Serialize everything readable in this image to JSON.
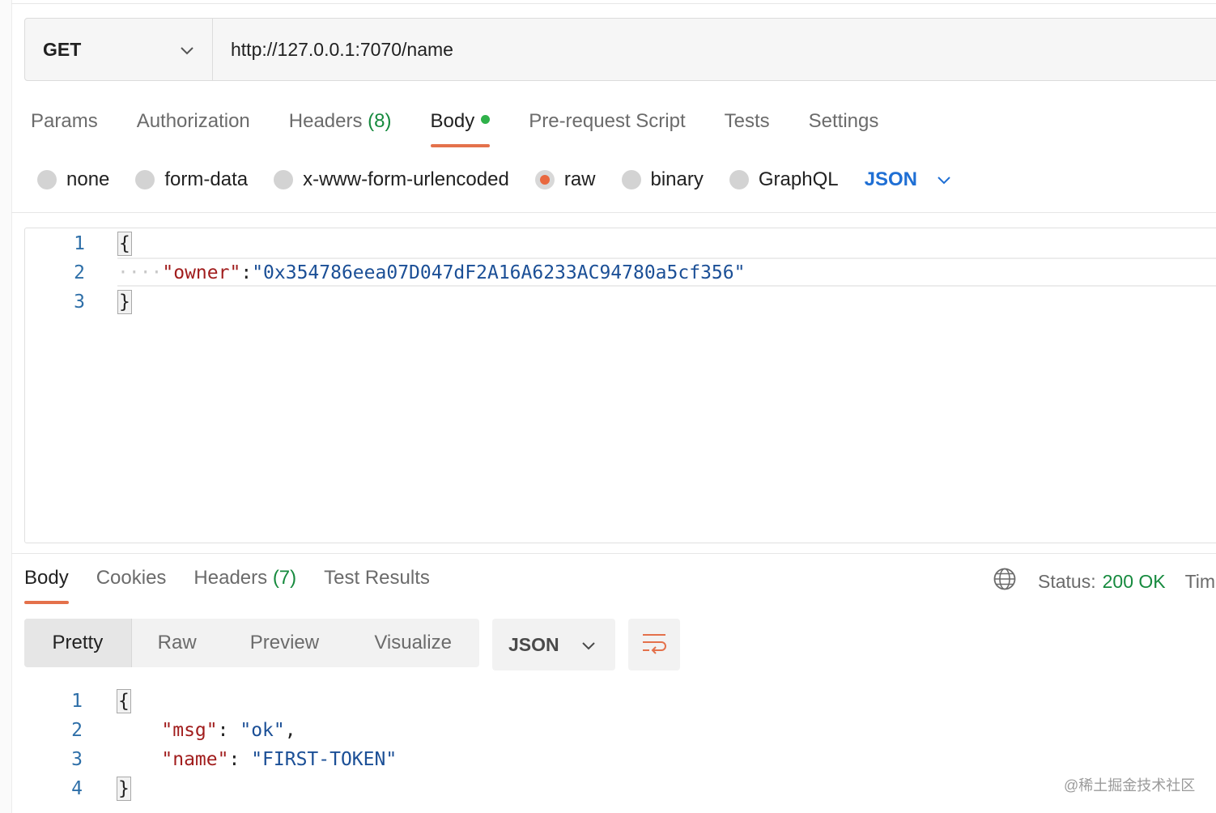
{
  "request": {
    "method": "GET",
    "url": "http://127.0.0.1:7070/name",
    "tabs": [
      {
        "label": "Params"
      },
      {
        "label": "Authorization"
      },
      {
        "label": "Headers",
        "count": "(8)"
      },
      {
        "label": "Body",
        "active": true,
        "indicator": "green-dot"
      },
      {
        "label": "Pre-request Script"
      },
      {
        "label": "Tests"
      },
      {
        "label": "Settings"
      }
    ],
    "body_types": [
      "none",
      "form-data",
      "x-www-form-urlencoded",
      "raw",
      "binary",
      "GraphQL"
    ],
    "body_type_selected": "raw",
    "language": "JSON",
    "editor": {
      "line_numbers": [
        "1",
        "2",
        "3"
      ],
      "open_brace": "{",
      "indent": "····",
      "key": "\"owner\"",
      "colon": ":",
      "value": "\"0x354786eea07D047dF2A16A6233AC94780a5cf356\"",
      "close_brace": "}"
    }
  },
  "response": {
    "tabs": [
      {
        "label": "Body",
        "active": true
      },
      {
        "label": "Cookies"
      },
      {
        "label": "Headers",
        "count": "(7)"
      },
      {
        "label": "Test Results"
      }
    ],
    "status_label": "Status:",
    "status_value": "200 OK",
    "time_label": "Tim",
    "view_modes": [
      "Pretty",
      "Raw",
      "Preview",
      "Visualize"
    ],
    "view_selected": "Pretty",
    "language": "JSON",
    "editor": {
      "line_numbers": [
        "1",
        "2",
        "3",
        "4"
      ],
      "open_brace": "{",
      "close_brace": "}",
      "msg_key": "\"msg\"",
      "msg_val": "\"ok\"",
      "name_key": "\"name\"",
      "name_val": "\"FIRST-TOKEN\""
    }
  },
  "watermark": "@稀土掘金技术社区",
  "colors": {
    "accent": "#e4714b",
    "success": "#168a3e",
    "link": "#1f6fd4",
    "json_key": "#a11d1d",
    "json_string": "#1b4f96"
  },
  "icons": [
    "chevron-down-icon",
    "globe-icon",
    "wrap-lines-icon"
  ]
}
